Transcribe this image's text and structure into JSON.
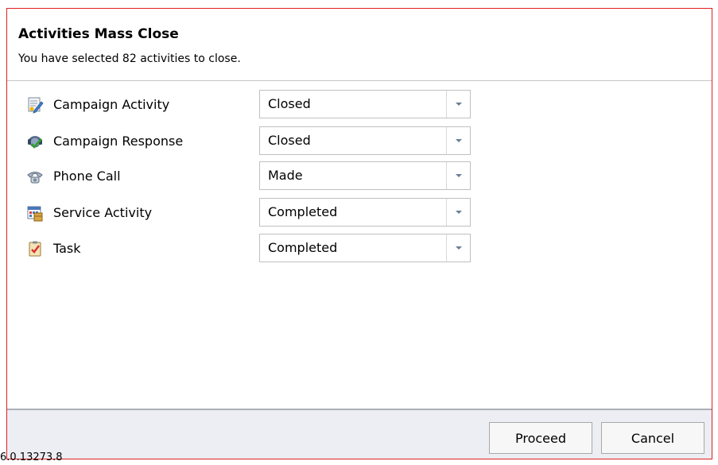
{
  "dialog": {
    "title": "Activities Mass Close",
    "subtitle": "You have selected 82 activities to close."
  },
  "rows": [
    {
      "label": "Campaign Activity",
      "value": "Closed",
      "icon": "campaign-activity-icon"
    },
    {
      "label": "Campaign Response",
      "value": "Closed",
      "icon": "campaign-response-icon"
    },
    {
      "label": "Phone Call",
      "value": "Made",
      "icon": "phone-call-icon"
    },
    {
      "label": "Service Activity",
      "value": "Completed",
      "icon": "service-activity-icon"
    },
    {
      "label": "Task",
      "value": "Completed",
      "icon": "task-icon"
    }
  ],
  "buttons": {
    "proceed": "Proceed",
    "cancel": "Cancel"
  },
  "version": "6.0.13273.8",
  "colors": {
    "border": "#e02020",
    "footer_bg": "#eceef3"
  }
}
